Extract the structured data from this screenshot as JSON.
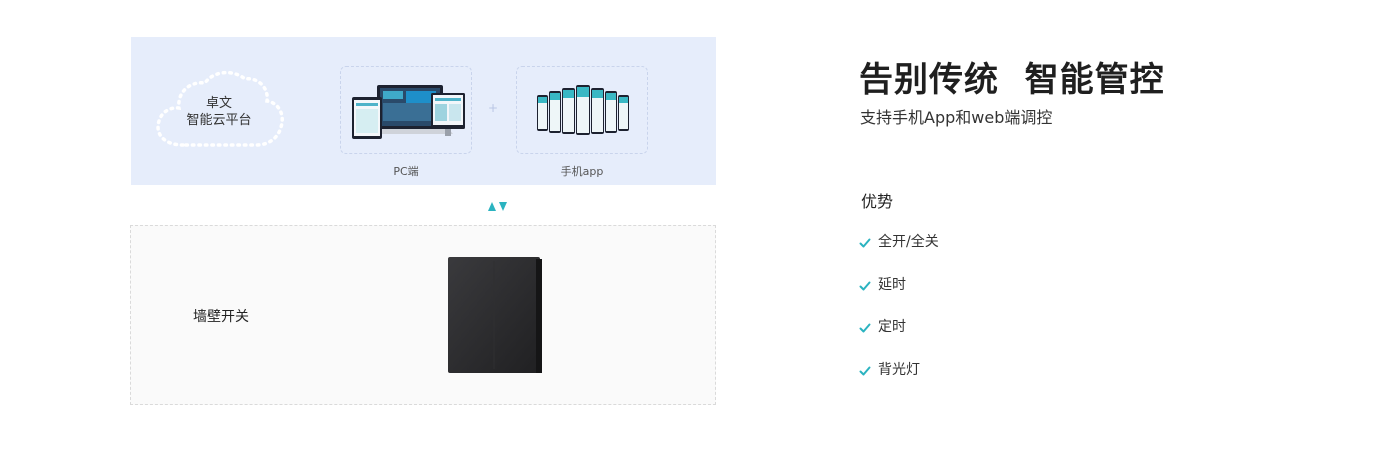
{
  "platform": {
    "cloud_label_line1": "卓文",
    "cloud_label_line2": "智能云平台",
    "pc_label": "PC端",
    "app_label": "手机app",
    "plus_symbol": "+"
  },
  "switch_panel": {
    "label": "墙壁开关"
  },
  "hero": {
    "headline": "告别传统  智能管控",
    "subtitle": "支持手机App和web端调控"
  },
  "advantages": {
    "heading": "优势",
    "items": [
      "全开/全关",
      "延时",
      "定时",
      "背光灯"
    ]
  },
  "colors": {
    "panel_bg": "#e6edfb",
    "accent_teal": "#2bb3c0",
    "switch_dark": "#2a2a2c"
  }
}
